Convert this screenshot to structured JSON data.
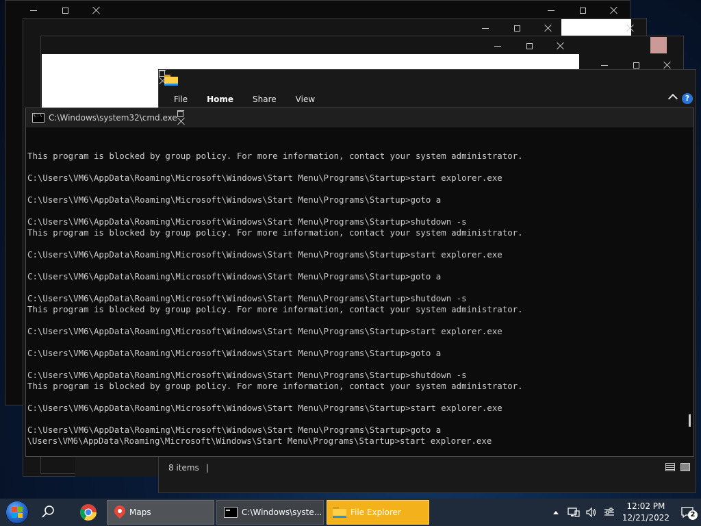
{
  "explorer": {
    "ribbon_tabs": [
      {
        "label": "File",
        "active": false
      },
      {
        "label": "Home",
        "active": true
      },
      {
        "label": "Share",
        "active": false
      },
      {
        "label": "View",
        "active": false
      }
    ],
    "status_items": "8 items",
    "status_sep": "|",
    "help_label": "?"
  },
  "cmd": {
    "title": "C:\\Windows\\system32\\cmd.exe",
    "lines": [
      "This program is blocked by group policy. For more information, contact your system administrator.",
      "",
      "C:\\Users\\VM6\\AppData\\Roaming\\Microsoft\\Windows\\Start Menu\\Programs\\Startup>start explorer.exe",
      "",
      "C:\\Users\\VM6\\AppData\\Roaming\\Microsoft\\Windows\\Start Menu\\Programs\\Startup>goto a",
      "",
      "C:\\Users\\VM6\\AppData\\Roaming\\Microsoft\\Windows\\Start Menu\\Programs\\Startup>shutdown -s",
      "This program is blocked by group policy. For more information, contact your system administrator.",
      "",
      "C:\\Users\\VM6\\AppData\\Roaming\\Microsoft\\Windows\\Start Menu\\Programs\\Startup>start explorer.exe",
      "",
      "C:\\Users\\VM6\\AppData\\Roaming\\Microsoft\\Windows\\Start Menu\\Programs\\Startup>goto a",
      "",
      "C:\\Users\\VM6\\AppData\\Roaming\\Microsoft\\Windows\\Start Menu\\Programs\\Startup>shutdown -s",
      "This program is blocked by group policy. For more information, contact your system administrator.",
      "",
      "C:\\Users\\VM6\\AppData\\Roaming\\Microsoft\\Windows\\Start Menu\\Programs\\Startup>start explorer.exe",
      "",
      "C:\\Users\\VM6\\AppData\\Roaming\\Microsoft\\Windows\\Start Menu\\Programs\\Startup>goto a",
      "",
      "C:\\Users\\VM6\\AppData\\Roaming\\Microsoft\\Windows\\Start Menu\\Programs\\Startup>shutdown -s",
      "This program is blocked by group policy. For more information, contact your system administrator.",
      "",
      "C:\\Users\\VM6\\AppData\\Roaming\\Microsoft\\Windows\\Start Menu\\Programs\\Startup>start explorer.exe",
      "",
      "C:\\Users\\VM6\\AppData\\Roaming\\Microsoft\\Windows\\Start Menu\\Programs\\Startup>goto a"
    ],
    "partial_line": ":\\Users\\VM6\\AppData\\Roaming\\Microsoft\\Windows\\Start Menu\\Programs\\Startup>start explorer.exe"
  },
  "taskbar": {
    "maps_label": "Maps",
    "cmd_label": "C:\\Windows\\syste...",
    "explorer_label": "File Explorer",
    "time": "12:02 PM",
    "date": "12/21/2022",
    "notification_count": "2"
  },
  "icons": {
    "start": "windows-start-icon",
    "search": "search-icon",
    "chrome": "chrome-icon",
    "maps": "maps-pin-icon",
    "cmd": "cmd-icon",
    "folder": "folder-icon"
  },
  "colors": {
    "file_explorer_task": "#f3b21b",
    "console_text": "#cccccc",
    "console_bg": "#0c0c0c"
  }
}
